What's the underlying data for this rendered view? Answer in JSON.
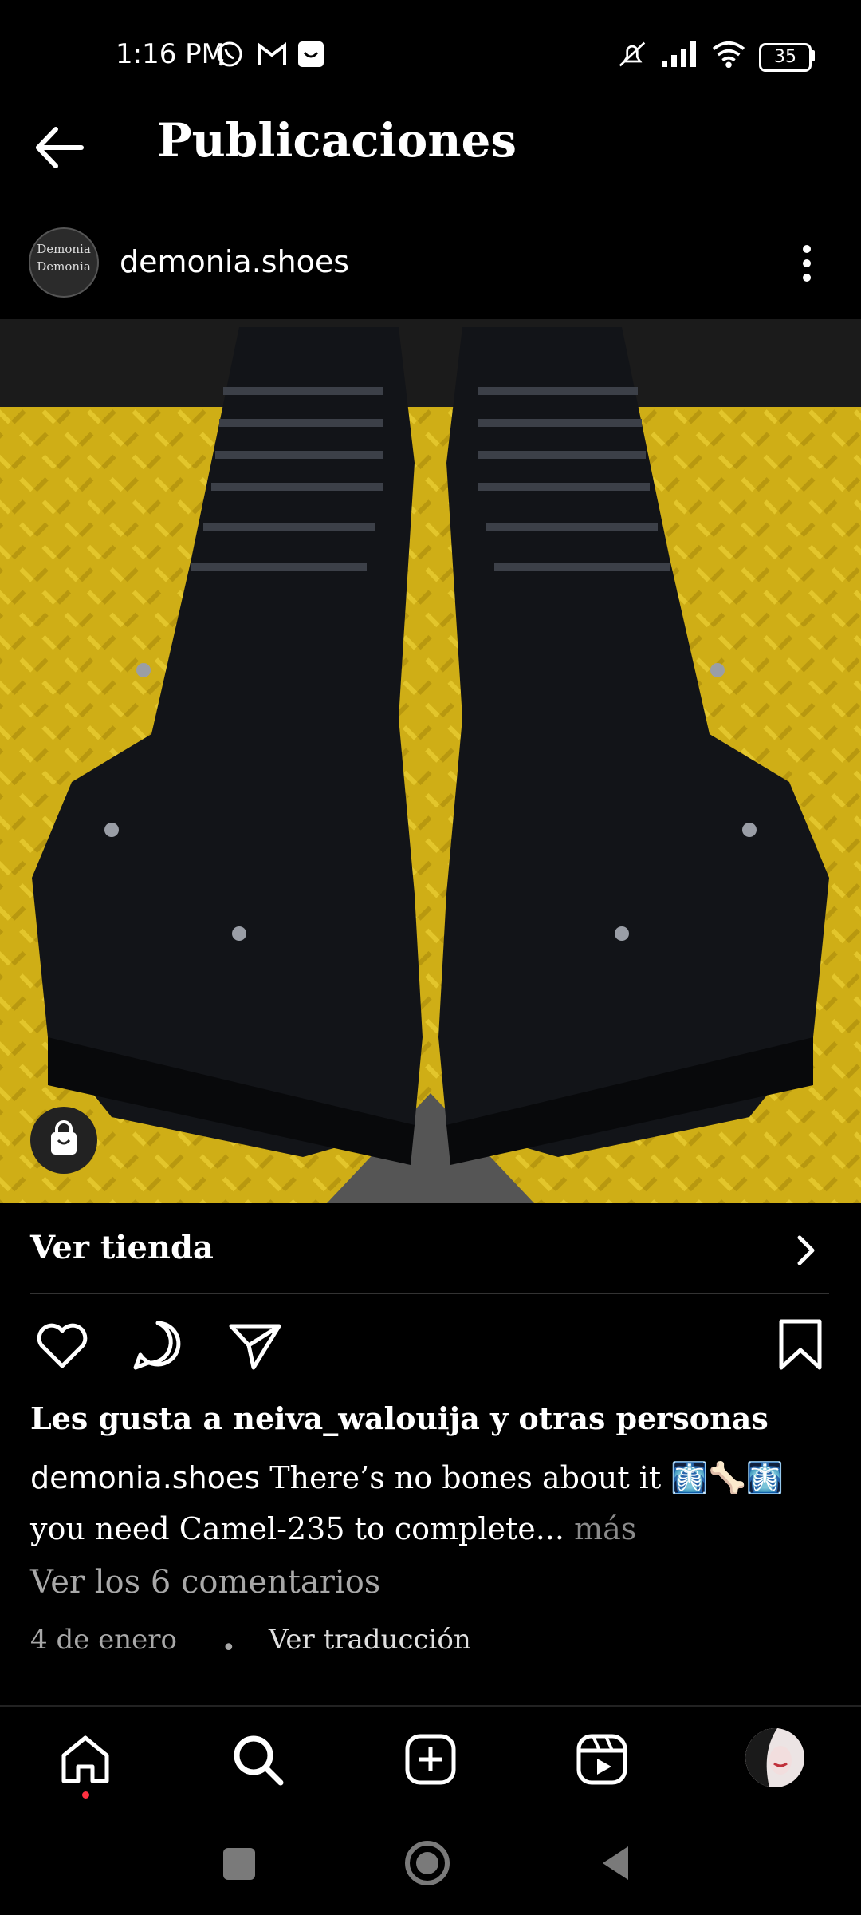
{
  "status_bar": {
    "time": "1:16 PM",
    "battery": "35",
    "icons": [
      "whatsapp-icon",
      "gmail-icon",
      "notification-icon",
      "mute-icon",
      "signal-icon",
      "wifi-icon",
      "battery-icon"
    ]
  },
  "header": {
    "title": "Publicaciones",
    "back_icon": "arrow-left-icon"
  },
  "post": {
    "username": "demonia.shoes",
    "avatar_text": "Demonia\nDemonia",
    "image_description_icon": "shopping-bag-icon",
    "shop_label": "Ver tienda",
    "likes_text": "Les gusta a neiva_walouija y otras personas",
    "caption_user": "demonia.shoes",
    "caption_text": "There’s no bones about it 🩻🦴🩻 you need Camel-235 to complete...",
    "caption_more": "más",
    "comments_link": "Ver los 6 comentarios",
    "date": "4 de enero",
    "separator": "•",
    "translate": "Ver traducción"
  },
  "bottom_nav": [
    "home-icon",
    "search-icon",
    "create-icon",
    "reels-icon",
    "profile-avatar"
  ],
  "colors": {
    "background": "#000000",
    "muted_text": "#a8a8a8",
    "notification_dot": "#ff3040",
    "photo_yellow": "#d4b418"
  }
}
